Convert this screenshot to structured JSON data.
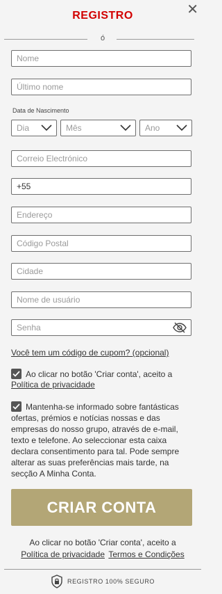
{
  "header": {
    "title": "REGISTRO",
    "or_text": "ó"
  },
  "fields": {
    "first_name": "Nome",
    "last_name": "Último nome",
    "dob_label": "Data de Nascimento",
    "day": "Dia",
    "month": "Mês",
    "year": "Ano",
    "email": "Correio Electrónico",
    "phone_value": "+55",
    "address": "Endereço",
    "postal_code": "Código Postal",
    "city": "Cidade",
    "username": "Nome de usuário",
    "password": "Senha"
  },
  "coupon_link": "Você tem um código de cupom? (opcional)",
  "consent1": {
    "text": "Ao clicar no botão 'Criar conta', aceito a",
    "link": "Política de privacidade",
    "checked": true
  },
  "consent2": {
    "text": "Mantenha-se informado sobre fantásticas ofertas, prémios e notícias nossas e das empresas do nosso grupo, através de e-mail, texto e telefone. Ao seleccionar esta caixa declara consentimento para tal. Pode sempre alterar as suas preferências mais tarde, na secção A Minha Conta.",
    "checked": true
  },
  "create_button": "CRIAR CONTA",
  "footer": {
    "text": "Ao clicar no botão 'Criar conta', aceito a",
    "privacy_link": "Política de privacidade",
    "terms_link": "Termos e Condições",
    "secure_text": "REGISTRO 100% SEGURO"
  },
  "colors": {
    "title": "#d20000",
    "button": "#b3a676",
    "background": "#f4f4f4"
  },
  "icons": {
    "close": "close-icon",
    "chevron": "chevron-down-icon",
    "eye": "eye-slash-icon",
    "check": "check-icon",
    "shield": "shield-lock-icon"
  }
}
